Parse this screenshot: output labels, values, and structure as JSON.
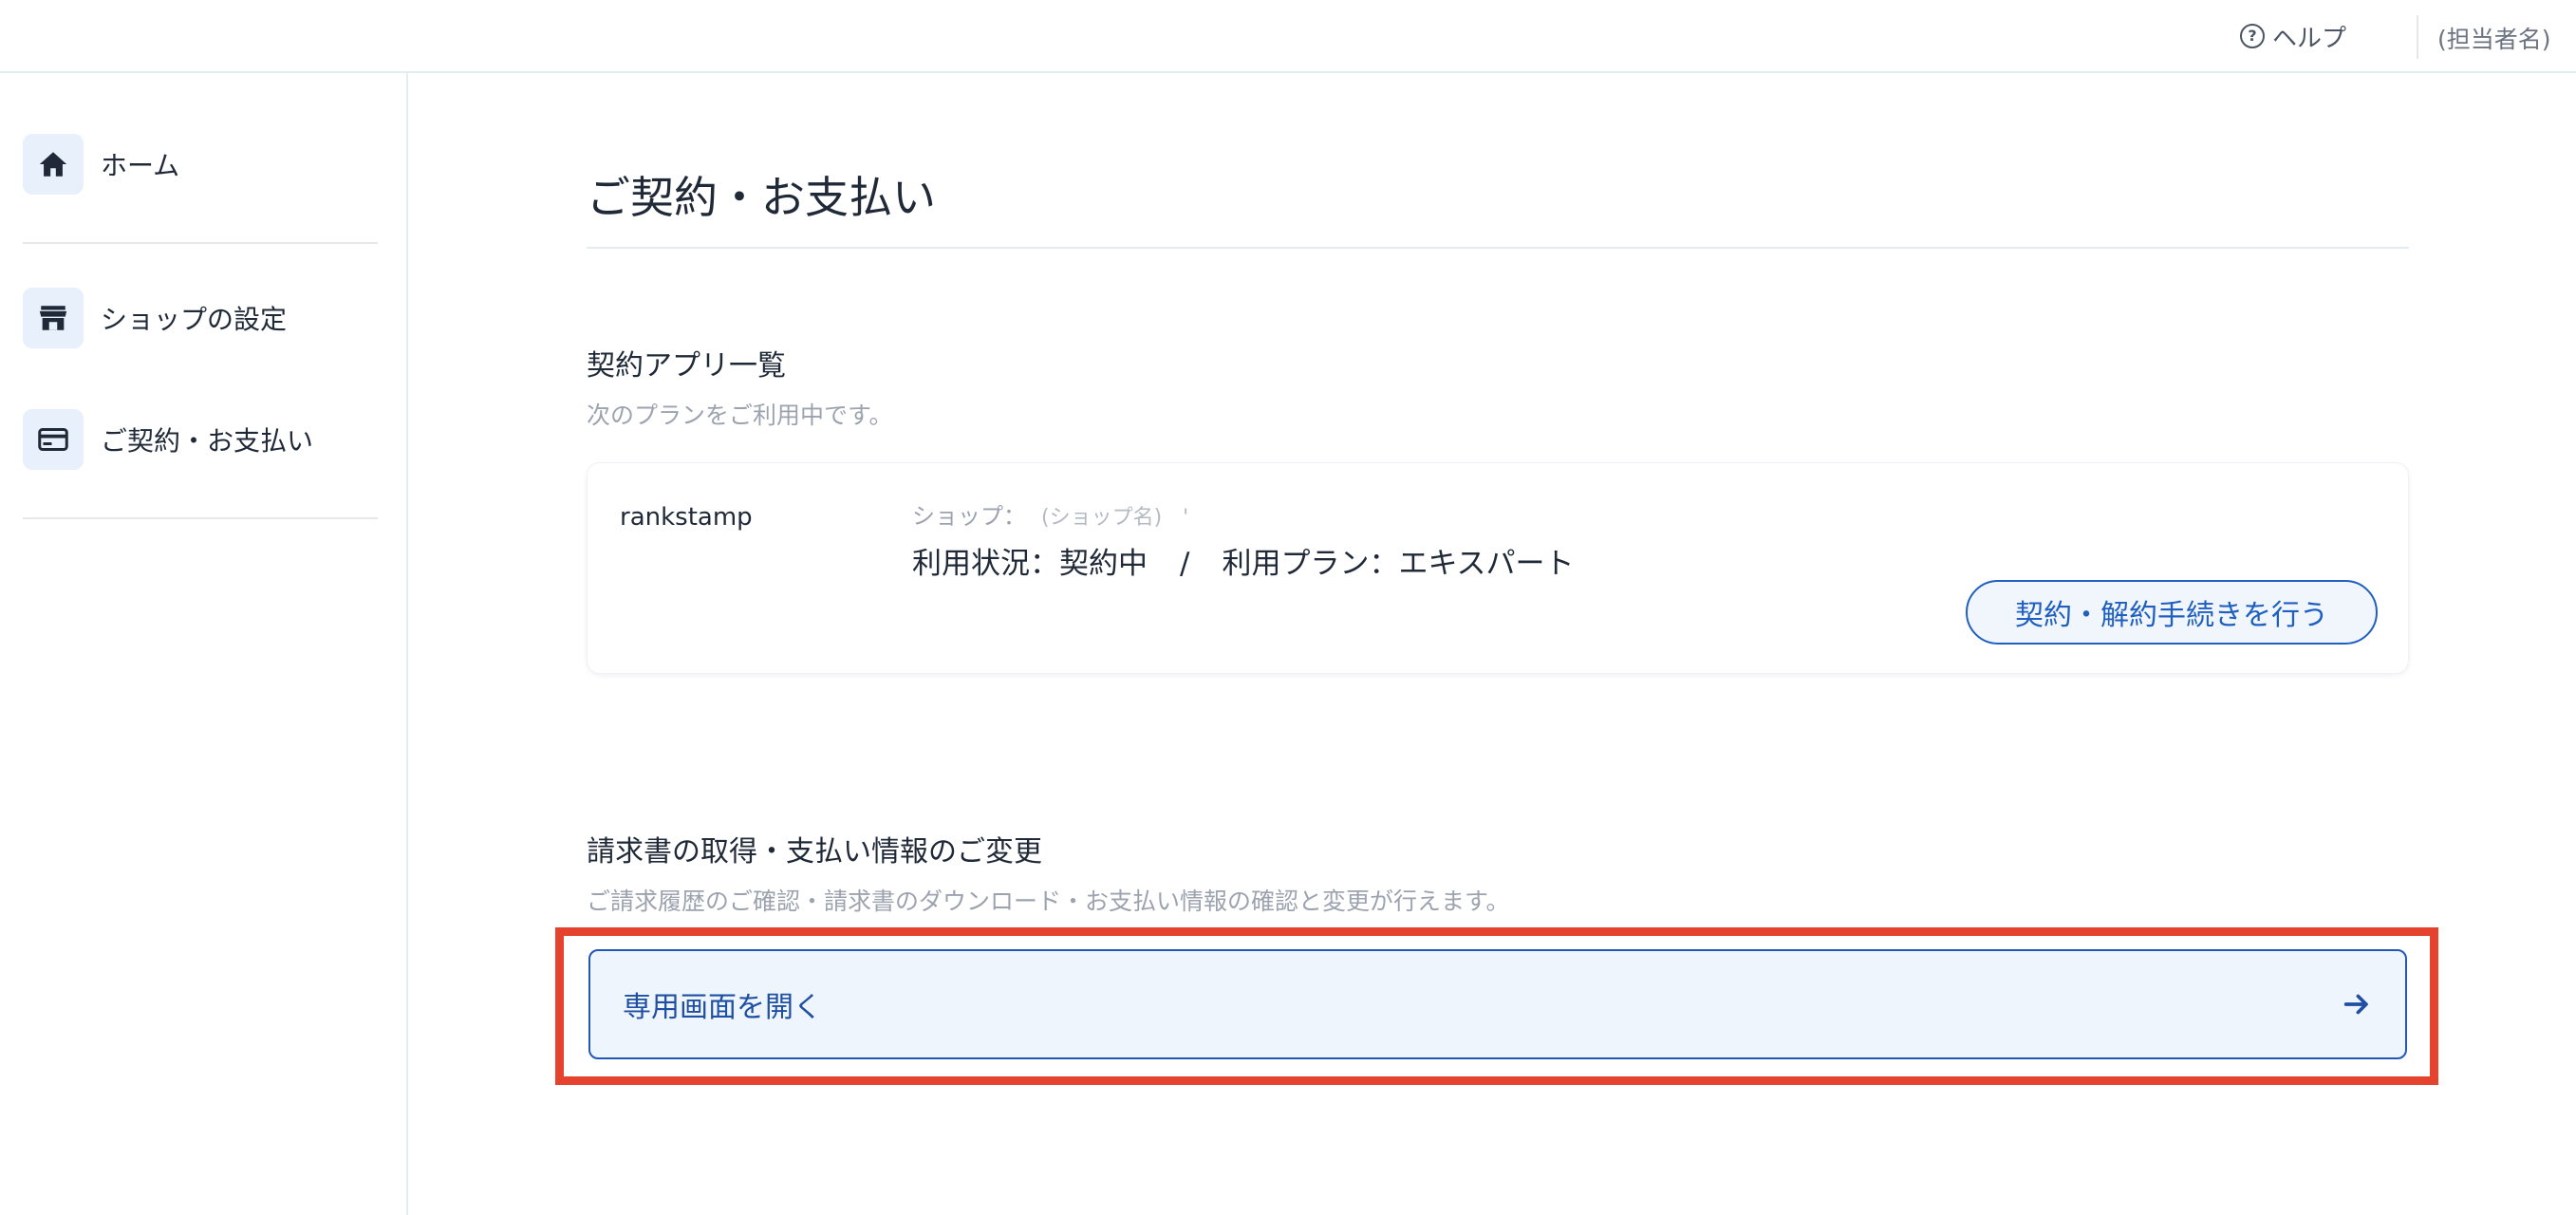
{
  "header": {
    "help_label": "ヘルプ",
    "help_icon_glyph": "?",
    "user_name": "(担当者名)"
  },
  "sidebar": {
    "items": [
      {
        "label": "ホーム",
        "icon": "home-icon"
      },
      {
        "label": "ショップの設定",
        "icon": "store-icon"
      },
      {
        "label": "ご契約・お支払い",
        "icon": "credit-card-icon"
      }
    ]
  },
  "main": {
    "title": "ご契約・お支払い",
    "contracts": {
      "heading": "契約アプリ一覧",
      "description": "次のプランをご利用中です。",
      "card": {
        "app_name": "rankstamp",
        "shop_label": "ショップ：",
        "shop_value": "(ショップ名)　'",
        "status": "利用状況：契約中",
        "separator": "/",
        "plan": "利用プラン：エキスパート",
        "action_label": "契約・解約手続きを行う"
      }
    },
    "billing": {
      "heading": "請求書の取得・支払い情報のご変更",
      "description": "ご請求履歴のご確認・請求書のダウンロード・お支払い情報の確認と変更が行えます。",
      "open_label": "専用画面を開く"
    }
  },
  "colors": {
    "accent": "#1f5fbf",
    "highlight": "#e5432d",
    "icon_bg": "#e8f0fb"
  }
}
